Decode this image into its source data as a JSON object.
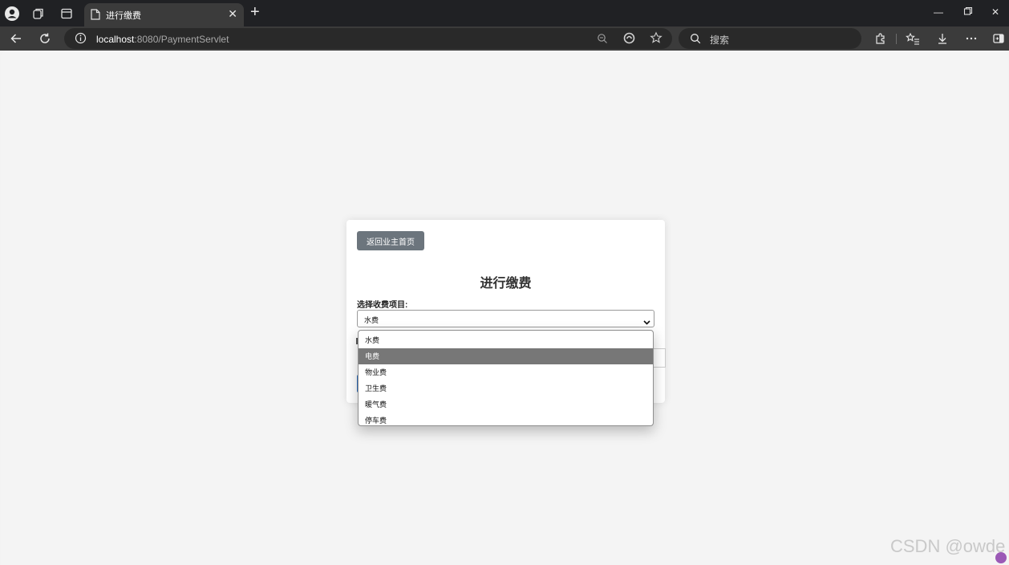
{
  "browser": {
    "tab_title": "进行缴费",
    "url_host": "localhost",
    "url_rest": ":8080/PaymentServlet",
    "search_placeholder": "搜索",
    "icons": [
      "profile-icon",
      "collections-icon",
      "tab-actions-icon",
      "page-icon",
      "close-icon",
      "new-tab-icon",
      "minimize-icon",
      "restore-icon",
      "window-close-icon",
      "back-icon",
      "refresh-icon",
      "info-icon",
      "zoom-icon",
      "read-aloud-icon",
      "favorite-icon",
      "search-icon",
      "extensions-icon",
      "favorites-icon",
      "downloads-icon",
      "more-icon",
      "sidebar-icon"
    ]
  },
  "page": {
    "back_button": "返回业主首页",
    "title": "进行缴费",
    "select_label": "选择收费项目:",
    "select_value": "水费",
    "options": [
      "水费",
      "电费",
      "物业费",
      "卫生费",
      "暖气费",
      "停车费"
    ],
    "highlighted_option": "电费"
  },
  "watermark": "CSDN @owde",
  "colors": {
    "back_button": "#6c757d",
    "highlight": "#777777",
    "browser_dark": "#202124"
  }
}
